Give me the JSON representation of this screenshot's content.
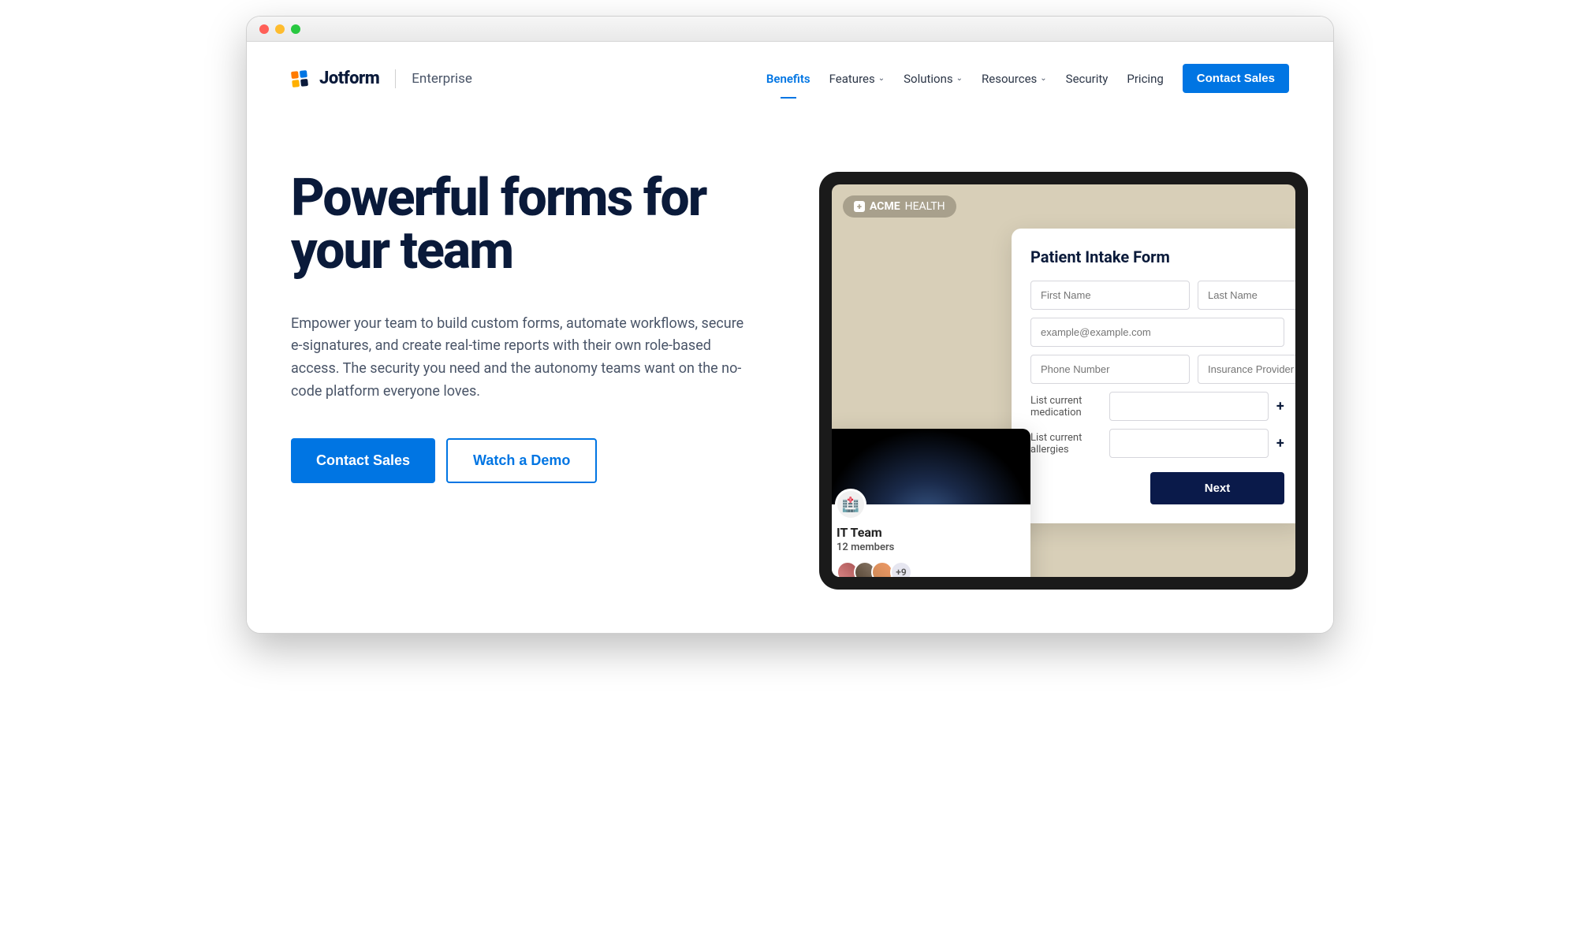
{
  "brand": {
    "name": "Jotform",
    "sub": "Enterprise"
  },
  "nav": {
    "items": [
      {
        "label": "Benefits",
        "active": true,
        "dropdown": false
      },
      {
        "label": "Features",
        "active": false,
        "dropdown": true
      },
      {
        "label": "Solutions",
        "active": false,
        "dropdown": true
      },
      {
        "label": "Resources",
        "active": false,
        "dropdown": true
      },
      {
        "label": "Security",
        "active": false,
        "dropdown": false
      },
      {
        "label": "Pricing",
        "active": false,
        "dropdown": false
      }
    ],
    "cta": "Contact Sales"
  },
  "hero": {
    "headline": "Powerful forms for your team",
    "description": "Empower your team to build custom forms, automate workflows, secure e-signatures, and create real-time reports with their own role-based access. The security you need and the autonomy teams want on the no-code platform everyone loves.",
    "primary_btn": "Contact Sales",
    "secondary_btn": "Watch a Demo"
  },
  "mock": {
    "acme_strong": "ACME",
    "acme_light": "HEALTH",
    "form_title": "Patient Intake Form",
    "first_name_ph": "First Name",
    "last_name_ph": "Last Name",
    "email_ph": "example@example.com",
    "phone_ph": "Phone Number",
    "insurance_ph": "Insurance Provider",
    "medication_label": "List current medication",
    "allergies_label": "List current allergies",
    "next_btn": "Next"
  },
  "team": {
    "name": "IT Team",
    "members": "12 members",
    "more": "+9"
  }
}
